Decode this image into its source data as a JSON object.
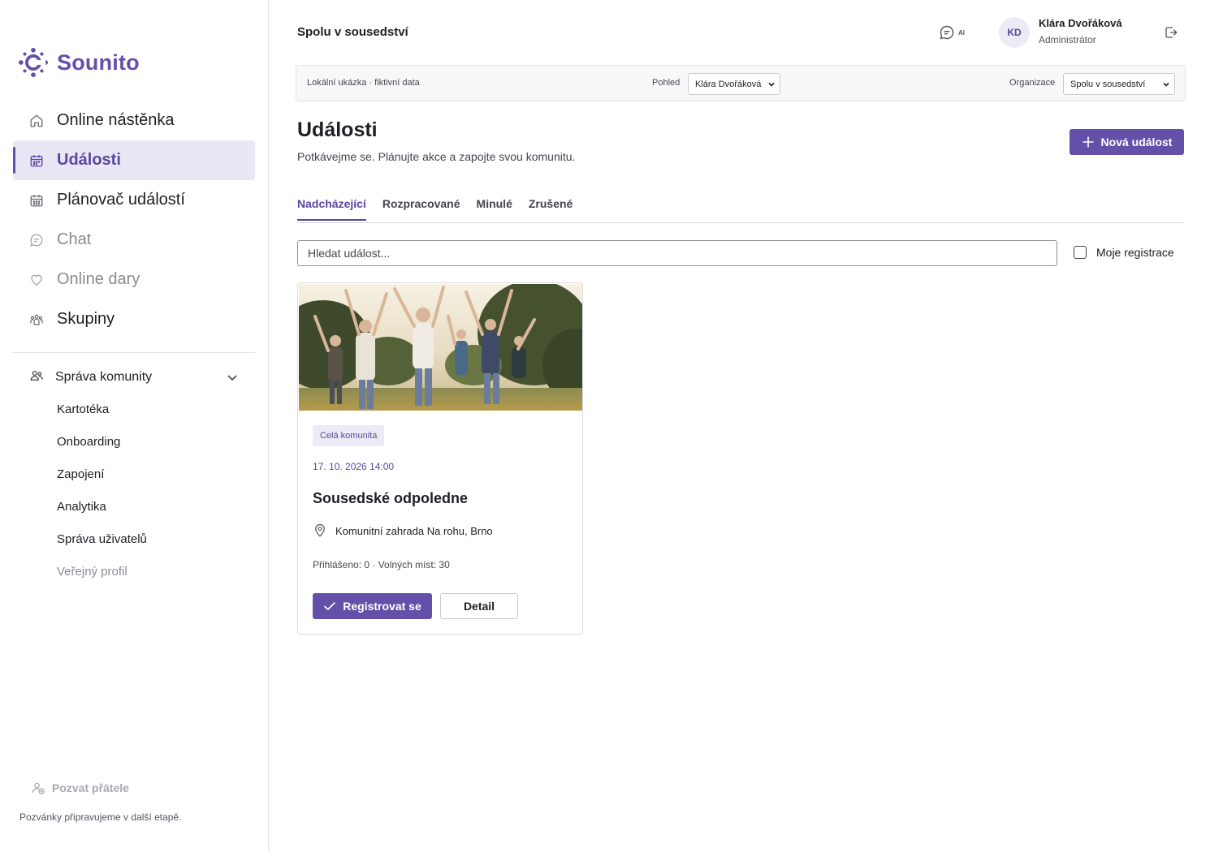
{
  "brand": {
    "name": "Sounito",
    "accent": "#6450a8"
  },
  "sidebar": {
    "items": [
      {
        "label": "Online nástěnka",
        "icon": "home-icon"
      },
      {
        "label": "Události",
        "icon": "calendar-icon",
        "active": true
      },
      {
        "label": "Plánovač událostí",
        "icon": "calendar-grid-icon"
      },
      {
        "label": "Chat",
        "icon": "chat-icon",
        "muted": true
      },
      {
        "label": "Online dary",
        "icon": "heart-icon",
        "muted": true
      },
      {
        "label": "Skupiny",
        "icon": "group-icon"
      }
    ],
    "section": {
      "label": "Správa komunity",
      "icon": "users-icon",
      "items": [
        {
          "label": "Kartotéka"
        },
        {
          "label": "Onboarding"
        },
        {
          "label": "Zapojení"
        },
        {
          "label": "Analytika"
        },
        {
          "label": "Správa uživatelů"
        },
        {
          "label": "Veřejný profil",
          "muted": true
        }
      ]
    },
    "invite": {
      "label": "Pozvat přátele",
      "note": "Pozvánky připravujeme v další etapě."
    }
  },
  "header": {
    "org_title": "Spolu v sousedství",
    "ai_label": "AI",
    "user": {
      "initials": "KD",
      "name": "Klára Dvořáková",
      "role": "Administrátor"
    }
  },
  "context_bar": {
    "note": "Lokální ukázka · fiktivní data",
    "view_label": "Pohled",
    "view_value": "Klára Dvořáková",
    "org_label": "Organizace",
    "org_value": "Spolu v sousedství"
  },
  "main": {
    "title": "Události",
    "subtitle": "Potkávejme se. Plánujte akce a zapojte svou komunitu.",
    "new_button": "Nová událost",
    "tabs": [
      {
        "label": "Nadcházející",
        "active": true
      },
      {
        "label": "Rozpracované"
      },
      {
        "label": "Minulé"
      },
      {
        "label": "Zrušené"
      }
    ],
    "search_placeholder": "Hledat událost...",
    "my_registrations_label": "Moje registrace",
    "events": [
      {
        "tag": "Celá komunita",
        "date": "17. 10. 2026 14:00",
        "title": "Sousedské odpoledne",
        "location": "Komunitní zahrada Na rohu, Brno",
        "stats": "Přihlášeno: 0 · Volných míst: 30",
        "register_label": "Registrovat se",
        "detail_label": "Detail"
      }
    ]
  }
}
